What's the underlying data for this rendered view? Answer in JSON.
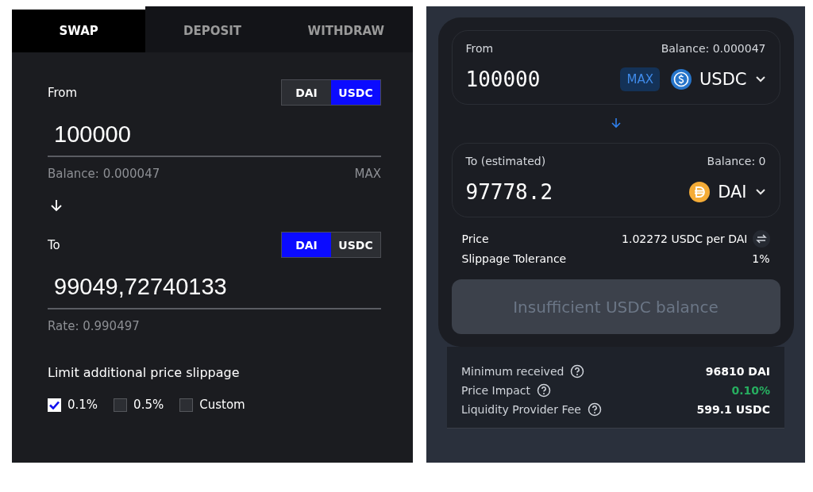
{
  "left_panel": {
    "tabs": [
      {
        "label": "SWAP",
        "selected": true
      },
      {
        "label": "DEPOSIT",
        "selected": false
      },
      {
        "label": "WITHDRAW",
        "selected": false
      }
    ],
    "from": {
      "label": "From",
      "tokens": [
        {
          "label": "DAI",
          "selected": false
        },
        {
          "label": "USDC",
          "selected": true
        }
      ],
      "value": "100000",
      "balance": "Balance: 0.000047",
      "max": "MAX"
    },
    "to": {
      "label": "To",
      "tokens": [
        {
          "label": "DAI",
          "selected": true
        },
        {
          "label": "USDC",
          "selected": false
        }
      ],
      "value": "99049,72740133",
      "rate": "Rate: 0.990497"
    },
    "slippage": {
      "title": "Limit additional price slippage",
      "options": [
        {
          "label": "0.1%",
          "checked": true
        },
        {
          "label": "0.5%",
          "checked": false
        },
        {
          "label": "Custom",
          "checked": false
        }
      ]
    }
  },
  "right_panel": {
    "from": {
      "label": "From",
      "balance": "Balance: 0.000047",
      "value": "100000",
      "max": "MAX",
      "token": "USDC"
    },
    "to": {
      "label": "To (estimated)",
      "balance": "Balance: 0",
      "value": "97778.2",
      "token": "DAI"
    },
    "price": {
      "label": "Price",
      "value": "1.02272 USDC per DAI"
    },
    "slippage": {
      "label": "Slippage Tolerance",
      "value": "1%"
    },
    "action_button": {
      "label": "Insufficient USDC balance",
      "disabled": true
    },
    "details": [
      {
        "label": "Minimum received",
        "value": "96810 DAI",
        "kind": "plain"
      },
      {
        "label": "Price Impact",
        "value": "0.10%",
        "kind": "positive"
      },
      {
        "label": "Liquidity Provider Fee",
        "value": "599.1 USDC",
        "kind": "plain"
      }
    ]
  }
}
